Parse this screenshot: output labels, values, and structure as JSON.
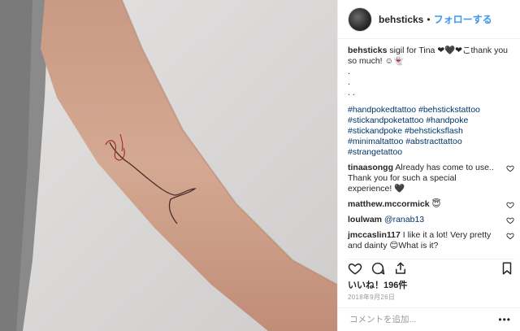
{
  "post": {
    "username": "behsticks",
    "separator": "•",
    "follow_label": "フォローする",
    "caption": "sigil for Tina ❤🖤❤こthank you so much! ☺👻",
    "caption_dots": [
      ".",
      ".",
      ". ."
    ],
    "hashtags": "#handpokedtattoo #behstickstattoo #stickandpoketattoo #handpoke #stickandpoke #behsticksflash #minimaltattoo #abstracttattoo #strangetattoo",
    "comments": [
      {
        "user": "tinaasongg",
        "text": "Already has come to use.. Thank you for such a special experience! 🖤",
        "mention": ""
      },
      {
        "user": "matthew.mccormick",
        "text": "😇",
        "mention": ""
      },
      {
        "user": "loulwam",
        "text": "",
        "mention": "@ranab13"
      },
      {
        "user": "jmccaslin117",
        "text": "I like it a lot! Very pretty and dainty 😊What is it?",
        "mention": ""
      }
    ],
    "likes_label": "いいね！196件",
    "date": "2018年9月26日",
    "comment_placeholder": "コメントを追加...",
    "more_label": "•••"
  },
  "icons": {
    "like": "heart-icon",
    "comment": "comment-icon",
    "share": "share-icon",
    "save": "bookmark-icon"
  },
  "colors": {
    "link": "#3897f0",
    "hashtag": "#003569",
    "muted": "#999999"
  }
}
